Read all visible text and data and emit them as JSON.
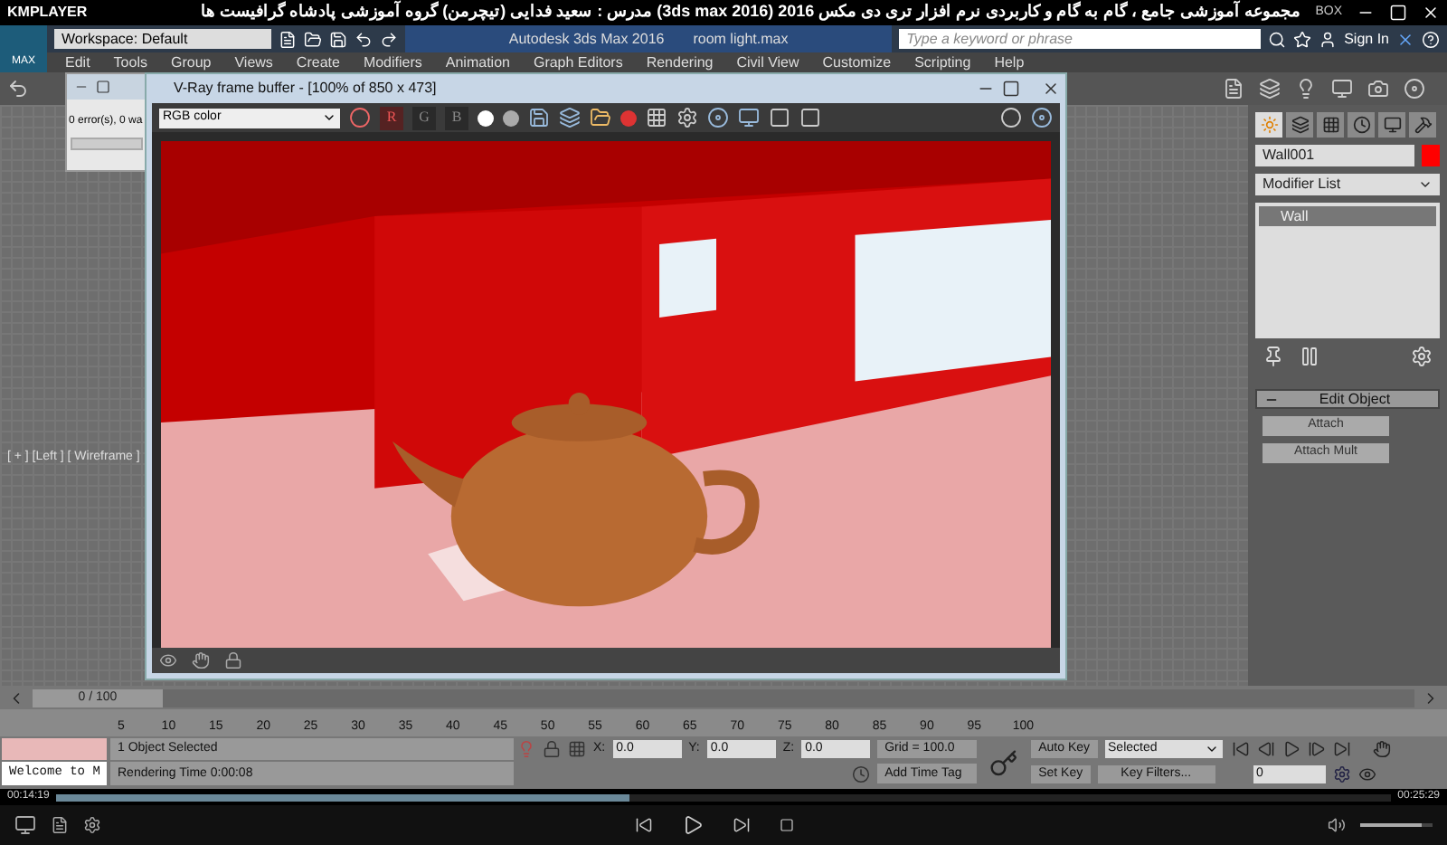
{
  "player": {
    "brand": "KMPLAYER",
    "title": "مجموعه آموزشی جامع ، گام به گام و کاربردی نرم افزار تری دی مکس 2016 (3ds max 2016)  مدرس : سعید فدایی (تیچرمن) گروه آموزشی پادشاه گرافیست ها",
    "box_label": "BOX",
    "time_elapsed": "00:14:19",
    "time_total": "00:25:29",
    "progress": {
      "level": 0.43
    },
    "volume": {
      "level": 0.85
    }
  },
  "app": {
    "logo": "MAX",
    "workspace": "Workspace: Default",
    "title": "Autodesk 3ds Max 2016",
    "file": "room light.max",
    "search_placeholder": "Type a keyword or phrase",
    "sign_in": "Sign In",
    "menu": [
      "Edit",
      "Tools",
      "Group",
      "Views",
      "Create",
      "Modifiers",
      "Animation",
      "Graph Editors",
      "Rendering",
      "Civil View",
      "Customize",
      "Scripting",
      "Help"
    ]
  },
  "viewport": {
    "label": "[ + ] [Left ] [ Wireframe ]"
  },
  "log_dialog": {
    "line": "0 error(s), 0 wa"
  },
  "frame_buffer": {
    "title": "V-Ray frame buffer - [100% of 850 x 473]",
    "channel": "RGB color",
    "channels": [
      {
        "label": "R",
        "selected": true
      },
      {
        "label": "G",
        "selected": false
      },
      {
        "label": "B",
        "selected": false
      }
    ]
  },
  "command_panel": {
    "tabs": [
      {
        "selected": true
      },
      {
        "selected": false
      },
      {
        "selected": false
      },
      {
        "selected": false
      },
      {
        "selected": false
      },
      {
        "selected": false
      }
    ],
    "object": {
      "name": "Wall001",
      "color": "#ff0000"
    },
    "modifier_list": "Modifier List",
    "stack": [
      {
        "label": "Wall",
        "selected": true
      }
    ],
    "rollout": {
      "title": "Edit Object",
      "expanded": true,
      "buttons": [
        "Attach",
        "Attach Mult"
      ]
    }
  },
  "timeline": {
    "frame": "0 / 100",
    "level": 0,
    "ticks": [
      "5",
      "10",
      "15",
      "20",
      "25",
      "30",
      "35",
      "40",
      "45",
      "50",
      "55",
      "60",
      "65",
      "70",
      "75",
      "80",
      "85",
      "90",
      "95",
      "100"
    ]
  },
  "status": {
    "prompt": "Welcome to M",
    "selection": "1 Object Selected",
    "render_time": "Rendering Time  0:00:08",
    "coords": [
      {
        "axis": "X:",
        "value": "0.0"
      },
      {
        "axis": "Y:",
        "value": "0.0"
      },
      {
        "axis": "Z:",
        "value": "0.0"
      }
    ],
    "grid": "Grid = 100.0",
    "add_time_tag": "Add Time Tag",
    "auto_key": "Auto Key",
    "key_mode": "Selected",
    "set_key": "Set Key",
    "key_filters": "Key Filters...",
    "current_frame": "0"
  }
}
